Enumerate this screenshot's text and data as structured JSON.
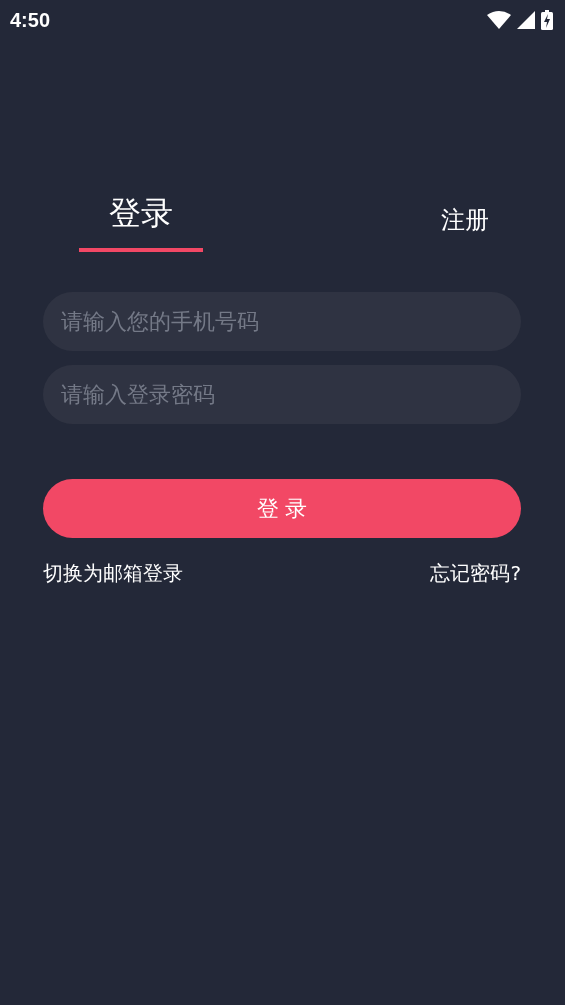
{
  "status_bar": {
    "time": "4:50"
  },
  "tabs": [
    {
      "label": "登录",
      "selected": true
    },
    {
      "label": "注册",
      "selected": false
    }
  ],
  "fields": [
    {
      "placeholder": "请输入您的手机号码"
    },
    {
      "placeholder": "请输入登录密码"
    }
  ],
  "login_button": "登 录",
  "links": {
    "switch": "切换为邮箱登录",
    "forgot": "忘记密码?"
  }
}
